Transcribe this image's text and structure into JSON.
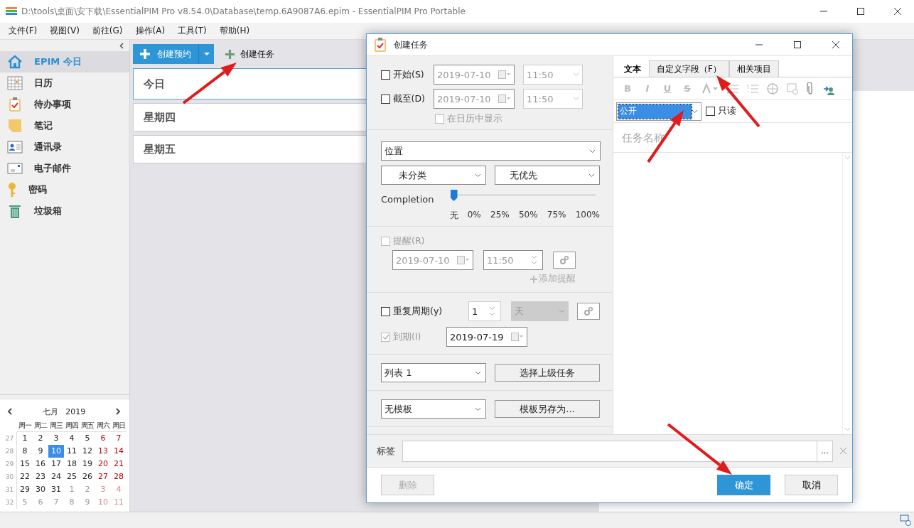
{
  "window": {
    "title": "D:\\tools\\桌面\\安下载\\EssentialPIM Pro v8.54.0\\Database\\temp.6A9087A6.epim - EssentialPIM Pro Portable"
  },
  "menu": [
    "文件(F)",
    "视图(V)",
    "前往(G)",
    "操作(A)",
    "工具(T)",
    "帮助(H)"
  ],
  "sidebar": {
    "items": [
      {
        "label": "EPIM 今日",
        "kind": "home",
        "selected": true
      },
      {
        "label": "日历",
        "kind": "calendar",
        "selected": false
      },
      {
        "label": "待办事项",
        "kind": "tasks",
        "selected": false
      },
      {
        "label": "笔记",
        "kind": "notes",
        "selected": false
      },
      {
        "label": "通讯录",
        "kind": "contacts",
        "selected": false
      },
      {
        "label": "电子邮件",
        "kind": "mail",
        "selected": false
      },
      {
        "label": "密码",
        "kind": "key",
        "selected": false
      },
      {
        "label": "垃圾箱",
        "kind": "trash",
        "selected": false
      }
    ]
  },
  "toolbar": {
    "primary_button": "创建预约",
    "secondary_button": "创建任务"
  },
  "day_panels": [
    {
      "label": "今日",
      "selected": true
    },
    {
      "label": "星期四",
      "selected": false
    },
    {
      "label": "星期五",
      "selected": false
    }
  ],
  "mini_calendar": {
    "month": "七月",
    "year": "2019",
    "weekdays": [
      "周一",
      "周二",
      "周三",
      "周四",
      "周五",
      "周六",
      "周日"
    ],
    "weeks": [
      {
        "number": "27",
        "days": [
          {
            "day": "1",
            "muted": false,
            "selected": false
          },
          {
            "day": "2",
            "muted": false,
            "selected": false
          },
          {
            "day": "3",
            "muted": false,
            "selected": false
          },
          {
            "day": "4",
            "muted": false,
            "selected": false
          },
          {
            "day": "5",
            "muted": false,
            "selected": false
          },
          {
            "day": "6",
            "muted": false,
            "selected": false
          },
          {
            "day": "7",
            "muted": false,
            "selected": false
          }
        ]
      },
      {
        "number": "28",
        "days": [
          {
            "day": "8",
            "muted": false,
            "selected": false
          },
          {
            "day": "9",
            "muted": false,
            "selected": false
          },
          {
            "day": "10",
            "muted": false,
            "selected": true
          },
          {
            "day": "11",
            "muted": false,
            "selected": false
          },
          {
            "day": "12",
            "muted": false,
            "selected": false
          },
          {
            "day": "13",
            "muted": false,
            "selected": false
          },
          {
            "day": "14",
            "muted": false,
            "selected": false
          }
        ]
      },
      {
        "number": "29",
        "days": [
          {
            "day": "15",
            "muted": false,
            "selected": false
          },
          {
            "day": "16",
            "muted": false,
            "selected": false
          },
          {
            "day": "17",
            "muted": false,
            "selected": false
          },
          {
            "day": "18",
            "muted": false,
            "selected": false
          },
          {
            "day": "19",
            "muted": false,
            "selected": false
          },
          {
            "day": "20",
            "muted": false,
            "selected": false
          },
          {
            "day": "21",
            "muted": false,
            "selected": false
          }
        ]
      },
      {
        "number": "30",
        "days": [
          {
            "day": "22",
            "muted": false,
            "selected": false
          },
          {
            "day": "23",
            "muted": false,
            "selected": false
          },
          {
            "day": "24",
            "muted": false,
            "selected": false
          },
          {
            "day": "25",
            "muted": false,
            "selected": false
          },
          {
            "day": "26",
            "muted": false,
            "selected": false
          },
          {
            "day": "27",
            "muted": false,
            "selected": false
          },
          {
            "day": "28",
            "muted": false,
            "selected": false
          }
        ]
      },
      {
        "number": "31",
        "days": [
          {
            "day": "29",
            "muted": false,
            "selected": false
          },
          {
            "day": "30",
            "muted": false,
            "selected": false
          },
          {
            "day": "31",
            "muted": false,
            "selected": false
          },
          {
            "day": "1",
            "muted": true,
            "selected": false
          },
          {
            "day": "2",
            "muted": true,
            "selected": false
          },
          {
            "day": "3",
            "muted": true,
            "selected": false
          },
          {
            "day": "4",
            "muted": true,
            "selected": false
          }
        ]
      },
      {
        "number": "32",
        "days": [
          {
            "day": "5",
            "muted": true,
            "selected": false
          },
          {
            "day": "6",
            "muted": true,
            "selected": false
          },
          {
            "day": "7",
            "muted": true,
            "selected": false
          },
          {
            "day": "8",
            "muted": true,
            "selected": false
          },
          {
            "day": "9",
            "muted": true,
            "selected": false
          },
          {
            "day": "10",
            "muted": true,
            "selected": false
          },
          {
            "day": "11",
            "muted": true,
            "selected": false
          }
        ]
      }
    ]
  },
  "dialog": {
    "title": "创建任务",
    "start": {
      "label": "开始(S)",
      "checked": false,
      "date": "2019-07-10",
      "time": "11:50"
    },
    "due": {
      "label": "截至(D)",
      "checked": false,
      "date": "2019-07-10",
      "time": "11:50"
    },
    "show_in_calendar": {
      "label": "在日历中显示",
      "checked": false,
      "disabled": true
    },
    "location": "位置",
    "category": "未分类",
    "priority": "无优先",
    "completion": {
      "label": "Completion",
      "level": 0,
      "ticks": [
        "无",
        "0%",
        "25%",
        "50%",
        "75%",
        "100%"
      ]
    },
    "reminder": {
      "label": "提醒(R)",
      "checked": false,
      "date": "2019-07-10",
      "time": "11:50",
      "add_link": "添加提醒"
    },
    "recurrence": {
      "label": "重复周期(y)",
      "checked": false,
      "count": "1",
      "unit": "天"
    },
    "until": {
      "label": "到期(I)",
      "checked": true,
      "disabled": true,
      "date": "2019-07-19"
    },
    "list": "列表 1",
    "parent_button": "选择上级任务",
    "template": "无模板",
    "save_template_button": "模板另存为...",
    "tabs": [
      {
        "label": "文本",
        "selected": true
      },
      {
        "label": "自定义字段（F）",
        "selected": false
      },
      {
        "label": "相关项目",
        "selected": false
      }
    ],
    "format_buttons": [
      {
        "label": "B",
        "disabled": true
      },
      {
        "label": "I",
        "disabled": true
      },
      {
        "label": "U",
        "disabled": true
      },
      {
        "label": "S",
        "disabled": true
      }
    ],
    "visibility": "公开",
    "readonly": {
      "label": "只读",
      "checked": false
    },
    "name_placeholder": "任务名称",
    "tags_label": "标签",
    "tags_button": "...",
    "delete_button": {
      "label": "删除",
      "disabled": true
    },
    "ok_button": "确定",
    "cancel_button": "取消"
  }
}
